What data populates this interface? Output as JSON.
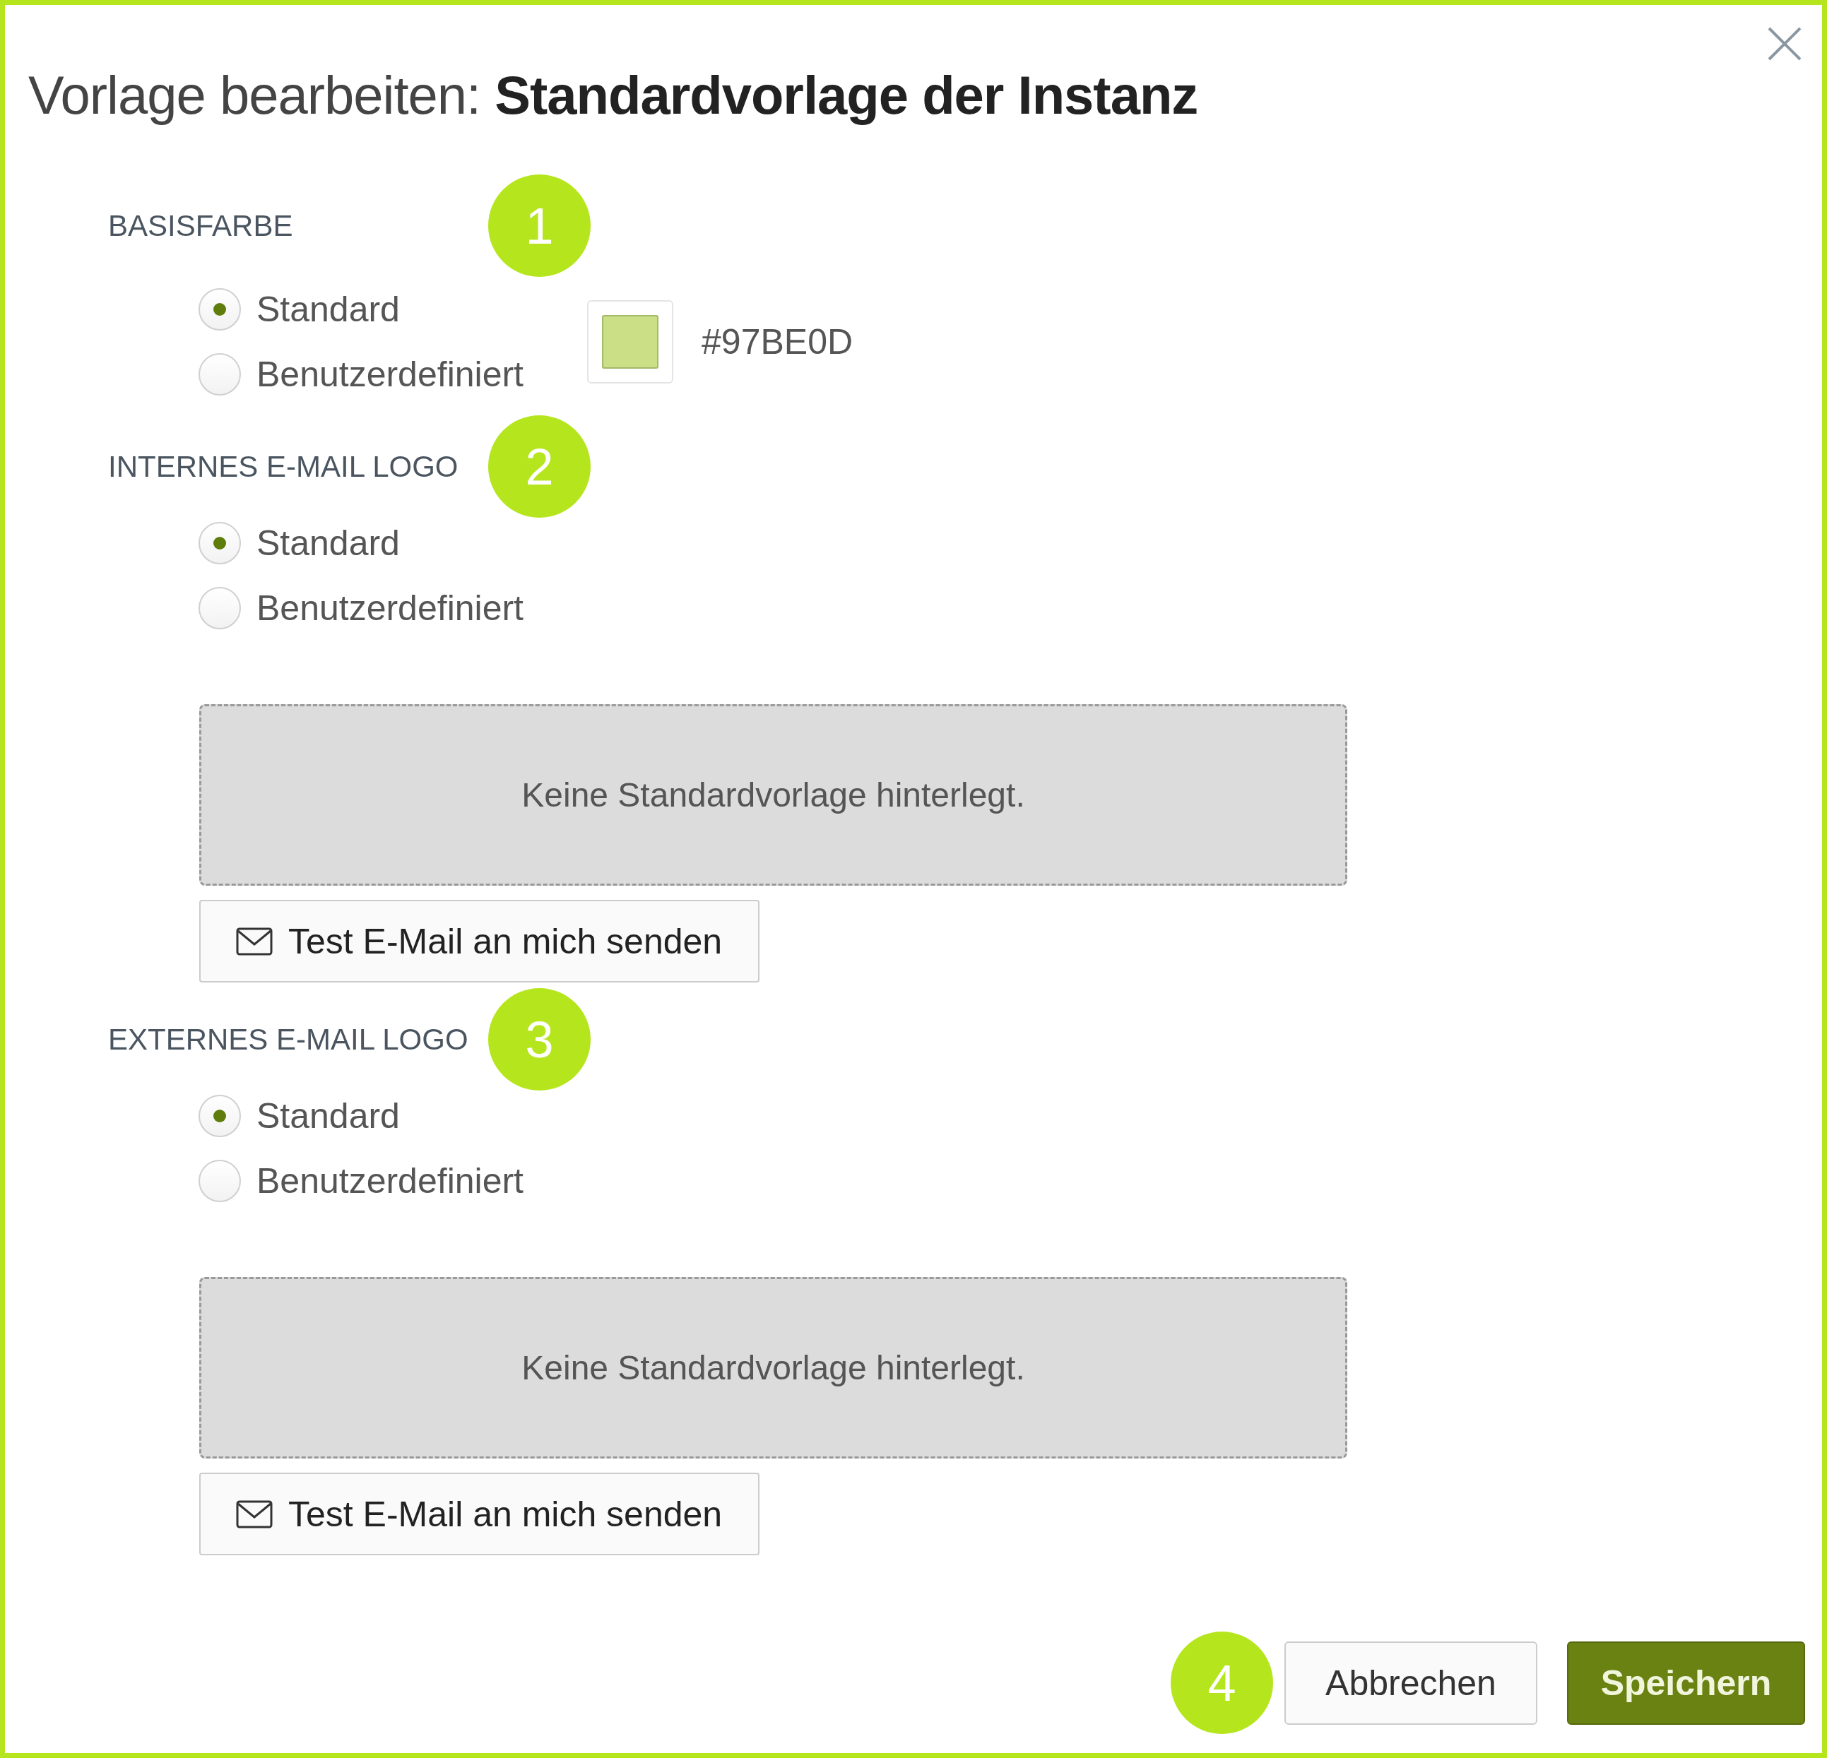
{
  "dialog": {
    "title": "Vorlage bearbeiten: **Standardvorlage der Instanz**"
  },
  "sections": [
    {
      "kind": "color",
      "label": "BASISFARBE",
      "badge": "1",
      "options": [
        {
          "label": "Standard",
          "selected": true
        },
        {
          "label": "Benutzerdefiniert",
          "selected": false
        }
      ],
      "hex": "#97BE0D"
    },
    {
      "kind": "logo",
      "label": "INTERNES E-MAIL LOGO",
      "badge": "2",
      "options": [
        {
          "label": "Standard",
          "selected": true
        },
        {
          "label": "Benutzerdefiniert",
          "selected": false
        }
      ],
      "preview_text": "Keine Standardvorlage hinterlegt.",
      "test_button": "Test E-Mail an mich senden"
    },
    {
      "kind": "logo",
      "label": "EXTERNES E-MAIL LOGO",
      "badge": "3",
      "options": [
        {
          "label": "Standard",
          "selected": true
        },
        {
          "label": "Benutzerdefiniert",
          "selected": false
        }
      ],
      "preview_text": "Keine Standardvorlage hinterlegt.",
      "test_button": "Test E-Mail an mich senden"
    }
  ],
  "footer": {
    "badge": "4",
    "buttons": [
      {
        "label": "Abbrechen",
        "kind": "secondary"
      },
      {
        "label": "Speichern",
        "kind": "primary"
      }
    ]
  }
}
